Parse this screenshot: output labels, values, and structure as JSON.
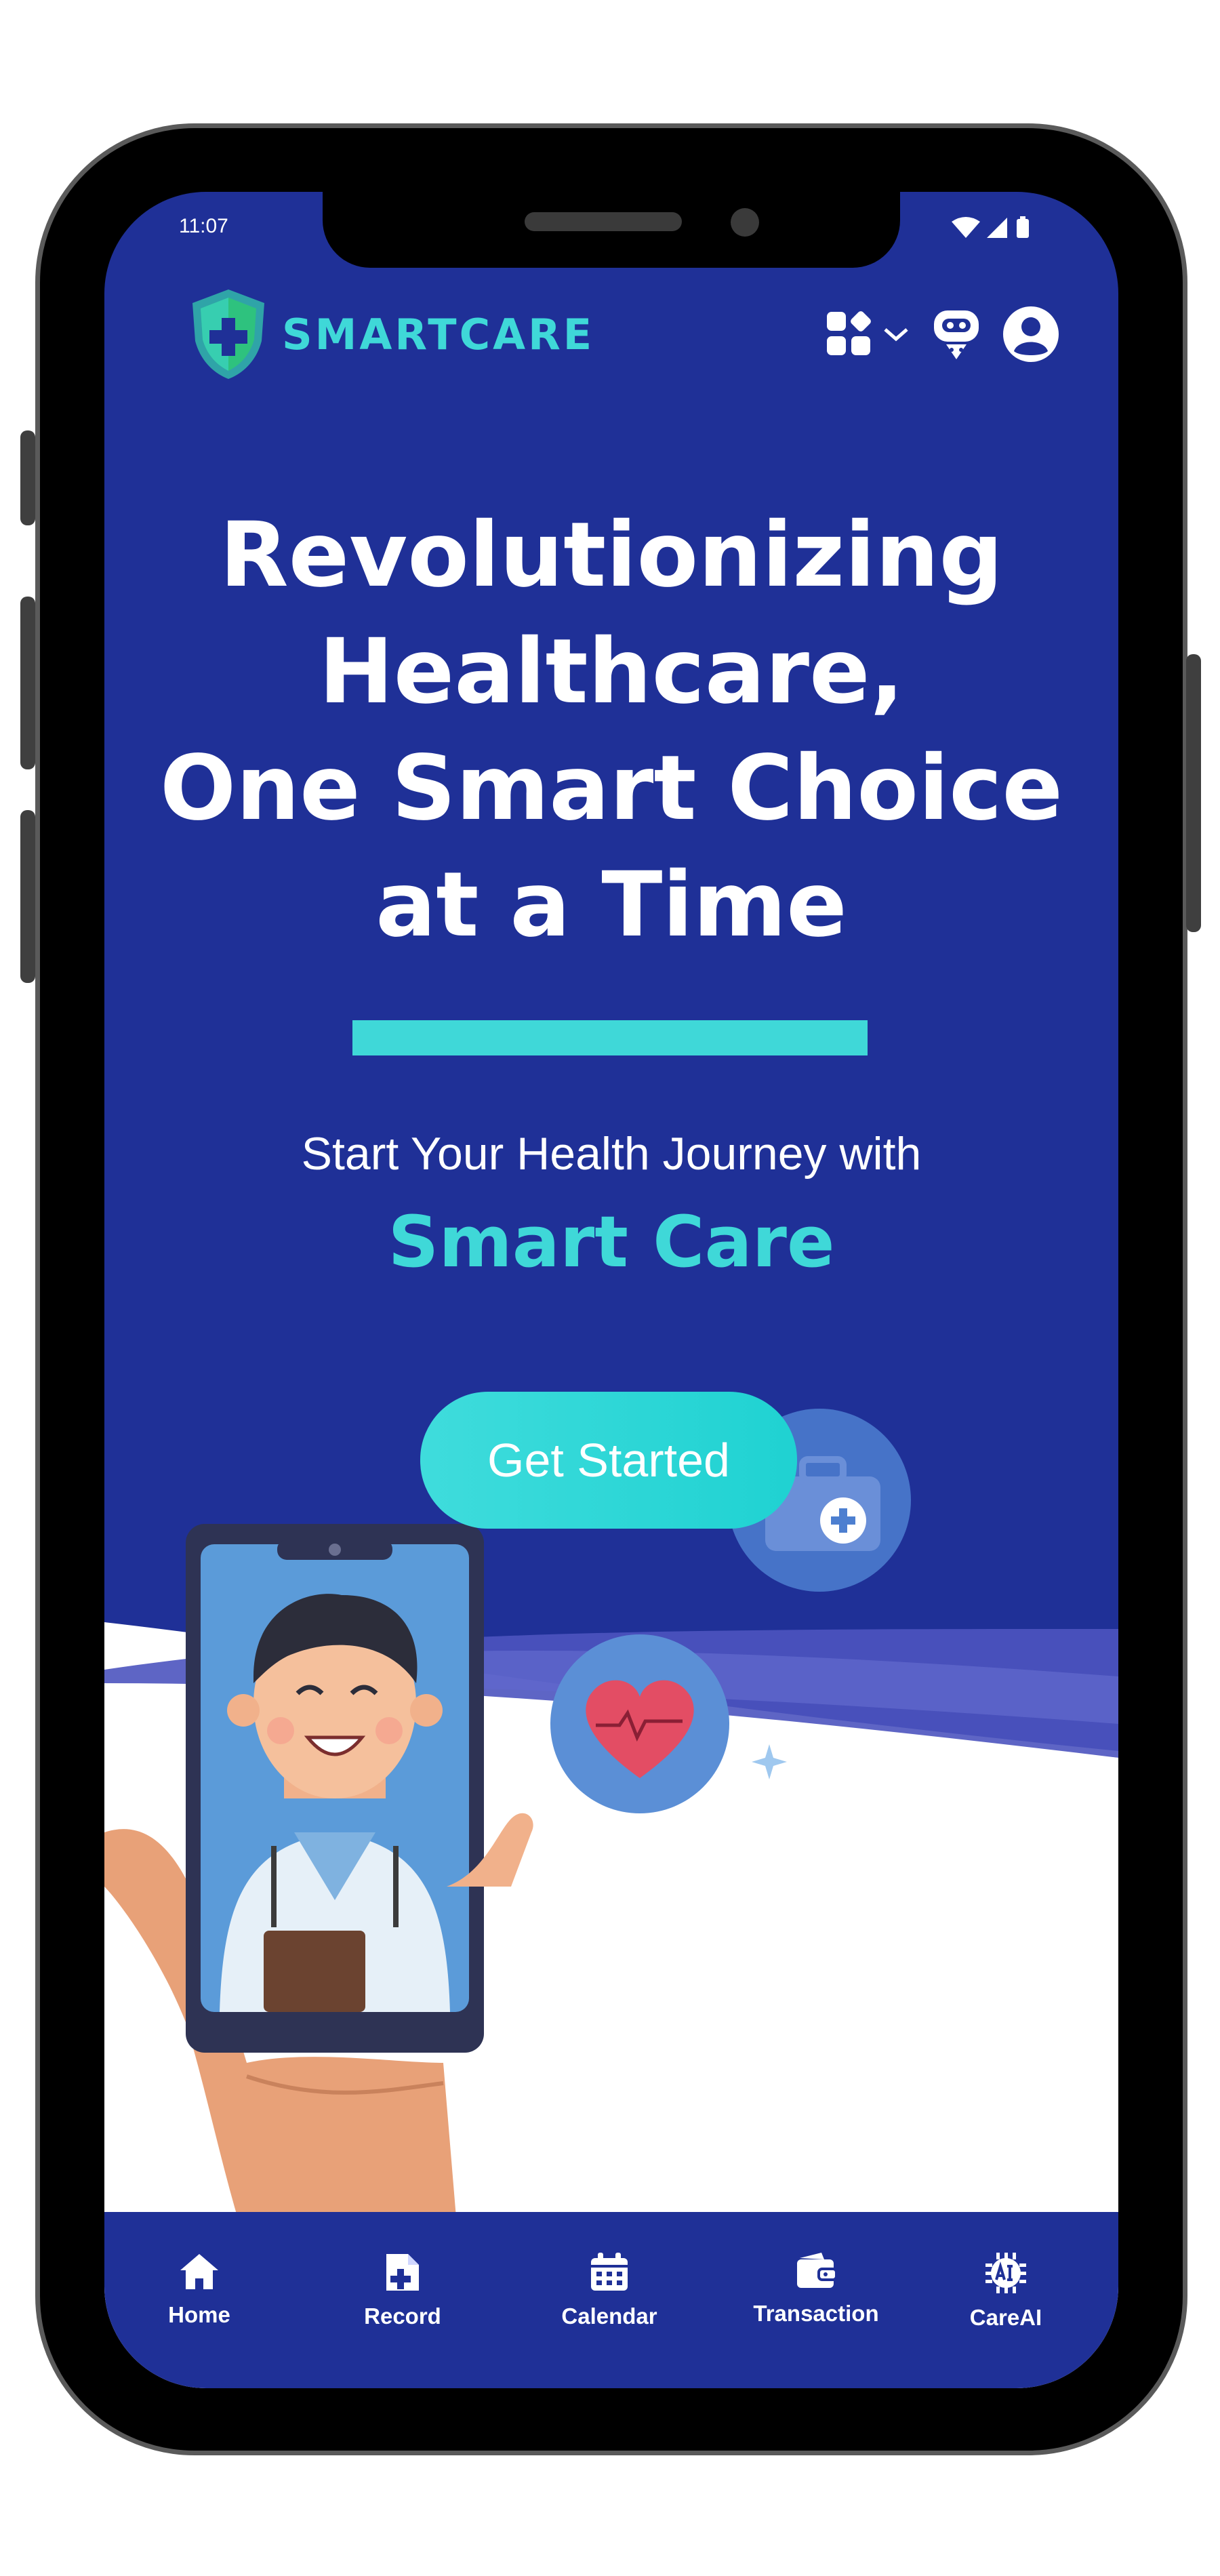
{
  "status_bar": {
    "time": "11:07",
    "icons": [
      "wifi-icon",
      "signal-icon",
      "battery-icon"
    ]
  },
  "header": {
    "logo_text": "SMARTCARE",
    "icons": [
      "grid-apps-icon",
      "chevron-down-icon",
      "chatbot-icon",
      "profile-icon"
    ]
  },
  "hero": {
    "title_lines": [
      "Revolutionizing",
      "Healthcare,",
      "One Smart Choice",
      "at a Time"
    ],
    "subtitle": "Start Your Health Journey with",
    "brand": "Smart Care",
    "cta_label": "Get Started"
  },
  "bottom_nav": {
    "items": [
      {
        "label": "Home",
        "icon": "home-icon"
      },
      {
        "label": "Record",
        "icon": "medical-record-icon"
      },
      {
        "label": "Calendar",
        "icon": "calendar-icon"
      },
      {
        "label": "Transaction",
        "icon": "wallet-icon"
      },
      {
        "label": "CareAI",
        "icon": "ai-chip-icon"
      }
    ]
  },
  "colors": {
    "primary": "#1f3097",
    "accent": "#3fd8d8",
    "text": "#ffffff"
  }
}
